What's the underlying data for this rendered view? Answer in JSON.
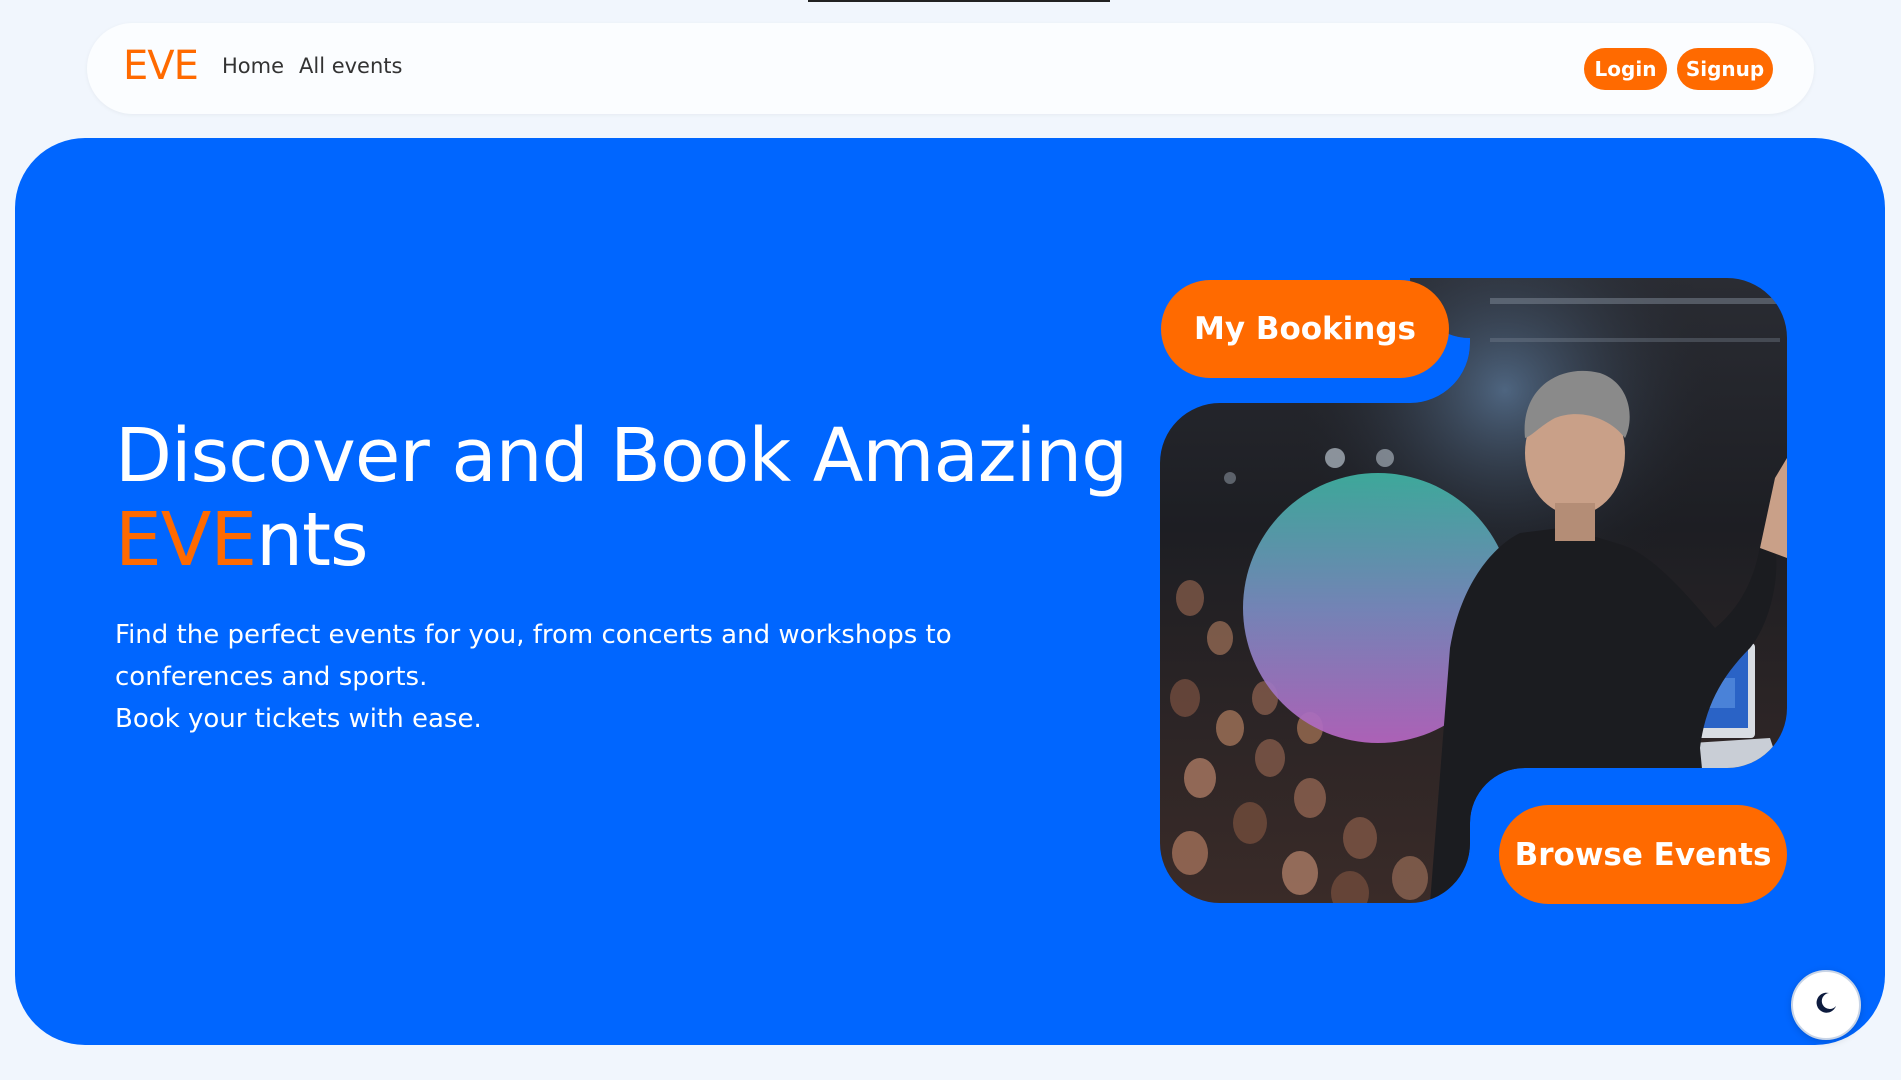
{
  "nav": {
    "logo": "EVE",
    "links": [
      "Home",
      "All events"
    ],
    "login_label": "Login",
    "signup_label": "Signup"
  },
  "hero": {
    "title_line1": "Discover and Book Amazing",
    "title_accent": "EVE",
    "title_rest": "nts",
    "description_line1": "Find the perfect events for you, from concerts and workshops to",
    "description_line2": "conferences and sports.",
    "description_line3": "Book your tickets with ease.",
    "bookings_label": "My Bookings",
    "browse_label": "Browse Events"
  },
  "theme_toggle": {
    "icon": "moon-icon"
  },
  "colors": {
    "background": "#f1f6fd",
    "hero": "#0066ff",
    "accent": "#ff6a00",
    "text_light": "#ffffff",
    "nav_text": "#333333"
  }
}
